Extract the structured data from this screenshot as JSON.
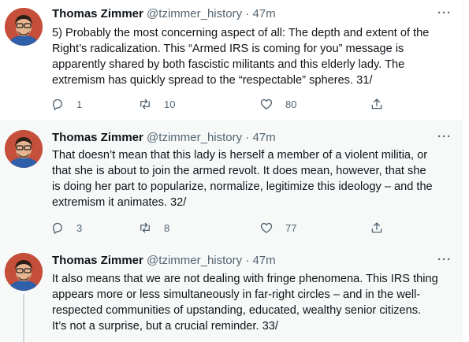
{
  "tweets": [
    {
      "author": {
        "name": "Thomas Zimmer",
        "handle": "@tzimmer_history",
        "separator": "·",
        "time": "47m"
      },
      "text": "5) Probably the most concerning aspect of all: The depth and extent of the\nRight’s radicalization. This “Armed IRS is coming for you” message is\napparently shared by both fascistic militants and this elderly lady. The\nextremism has quickly spread to the “respectable” spheres. 31/",
      "stats": {
        "replies": "1",
        "retweets": "10",
        "likes": "80"
      }
    },
    {
      "author": {
        "name": "Thomas Zimmer",
        "handle": "@tzimmer_history",
        "separator": "·",
        "time": "47m"
      },
      "text": "That doesn’t mean that this lady is herself a member of a violent militia, or\nthat she is about to join the armed revolt. It does mean, however, that she\nis doing her part to popularize, normalize, legitimize this ideology – and the\nextremism it animates. 32/",
      "stats": {
        "replies": "3",
        "retweets": "8",
        "likes": "77"
      }
    },
    {
      "author": {
        "name": "Thomas Zimmer",
        "handle": "@tzimmer_history",
        "separator": "·",
        "time": "47m"
      },
      "text": "It also means that we are not dealing with fringe phenomena. This IRS thing\nappears more or less simultaneously in far-right circles – and in the well-\nrespected communities of upstanding, educated, wealthy senior citizens.\nIt’s not a surprise, but a crucial reminder. 33/"
    }
  ],
  "icons": {
    "reply": "reply-icon",
    "retweet": "retweet-icon",
    "like": "heart-icon",
    "share": "share-icon",
    "more": "more-options-icon"
  },
  "colors": {
    "text": "#0f1419",
    "secondary": "#536471",
    "thread_bg": "#f7f9f9",
    "avatar_bg": "#c54f3a"
  }
}
